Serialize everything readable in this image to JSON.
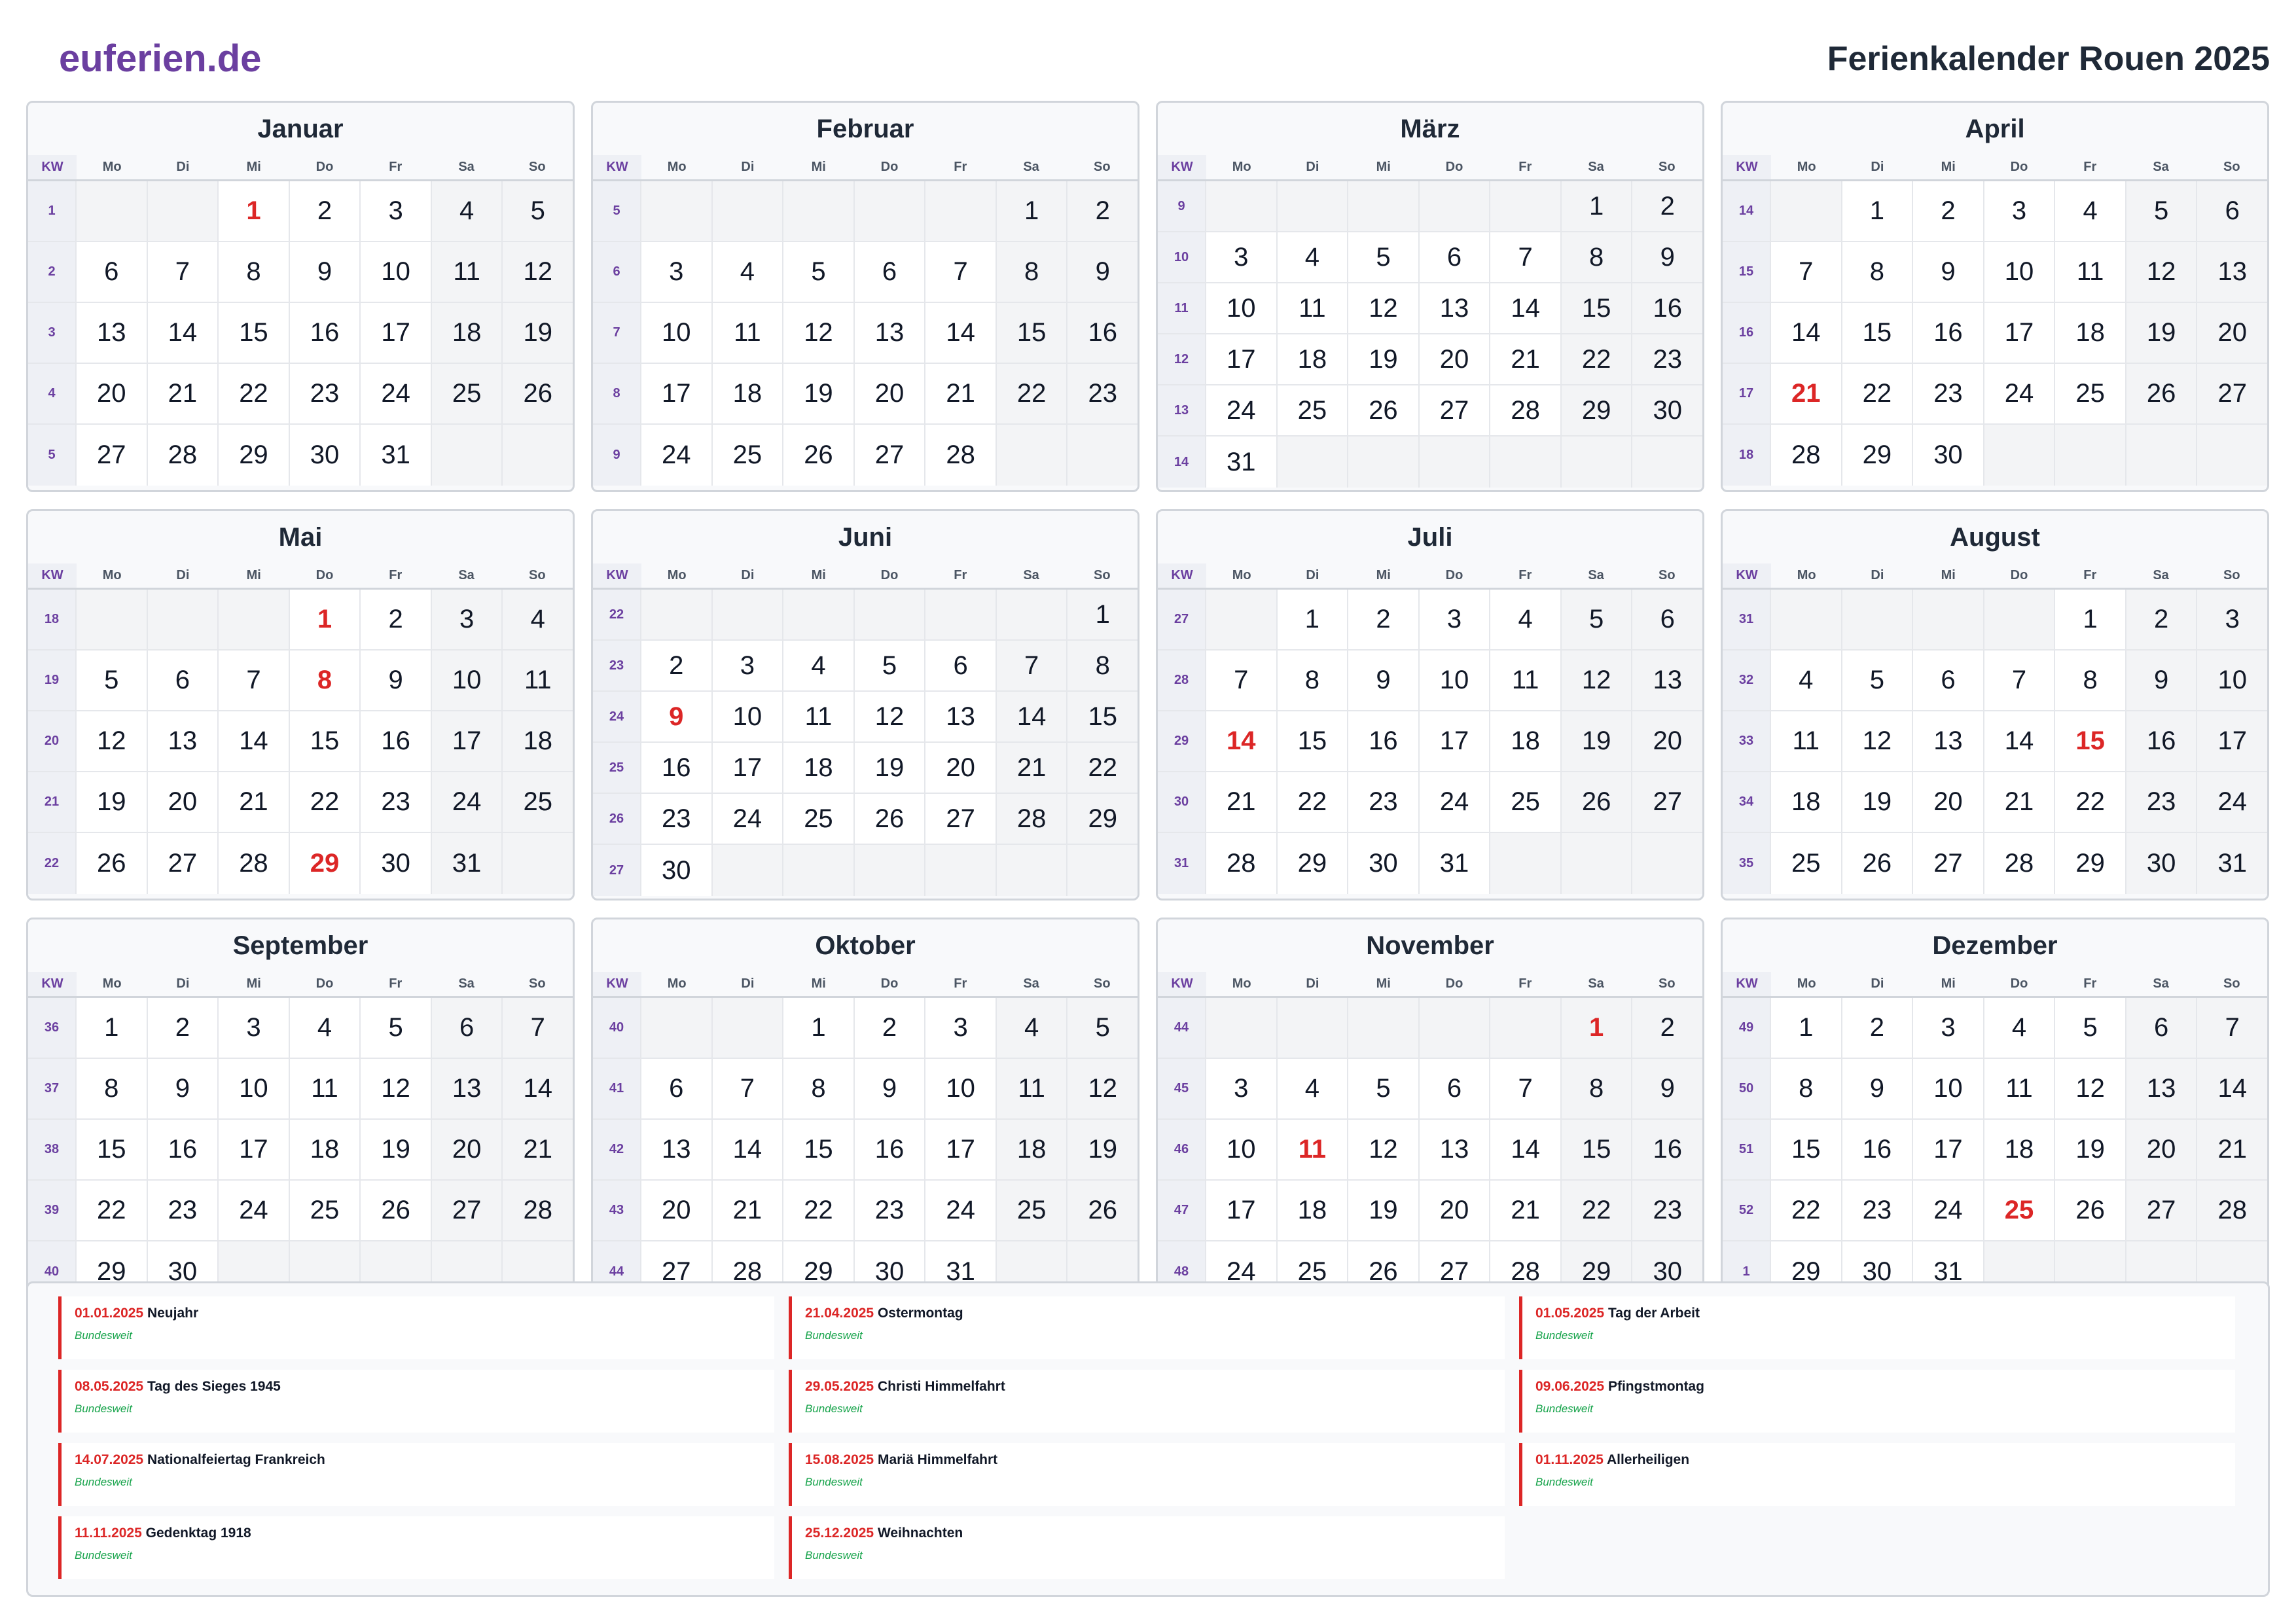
{
  "header": {
    "brand": "euferien.de",
    "title": "Ferienkalender Rouen 2025"
  },
  "calendar": {
    "kw_label": "KW",
    "weekday_labels": [
      "Mo",
      "Di",
      "Mi",
      "Do",
      "Fr",
      "Sa",
      "So"
    ],
    "months": [
      {
        "name": "Januar",
        "weeks": [
          1,
          2,
          3,
          4,
          5
        ],
        "offset": 2,
        "days": 31,
        "holidays": [
          1
        ]
      },
      {
        "name": "Februar",
        "weeks": [
          5,
          6,
          7,
          8,
          9
        ],
        "offset": 5,
        "days": 28,
        "holidays": []
      },
      {
        "name": "März",
        "weeks": [
          9,
          10,
          11,
          12,
          13,
          14
        ],
        "offset": 5,
        "days": 31,
        "holidays": []
      },
      {
        "name": "April",
        "weeks": [
          14,
          15,
          16,
          17,
          18
        ],
        "offset": 1,
        "days": 30,
        "holidays": [
          21
        ]
      },
      {
        "name": "Mai",
        "weeks": [
          18,
          19,
          20,
          21,
          22
        ],
        "offset": 3,
        "days": 31,
        "holidays": [
          1,
          8,
          29
        ]
      },
      {
        "name": "Juni",
        "weeks": [
          22,
          23,
          24,
          25,
          26,
          27
        ],
        "offset": 6,
        "days": 30,
        "holidays": [
          9
        ]
      },
      {
        "name": "Juli",
        "weeks": [
          27,
          28,
          29,
          30,
          31
        ],
        "offset": 1,
        "days": 31,
        "holidays": [
          14
        ]
      },
      {
        "name": "August",
        "weeks": [
          31,
          32,
          33,
          34,
          35
        ],
        "offset": 4,
        "days": 31,
        "holidays": [
          15
        ]
      },
      {
        "name": "September",
        "weeks": [
          36,
          37,
          38,
          39,
          40
        ],
        "offset": 0,
        "days": 30,
        "holidays": []
      },
      {
        "name": "Oktober",
        "weeks": [
          40,
          41,
          42,
          43,
          44
        ],
        "offset": 2,
        "days": 31,
        "holidays": []
      },
      {
        "name": "November",
        "weeks": [
          44,
          45,
          46,
          47,
          48
        ],
        "offset": 5,
        "days": 30,
        "holidays": [
          1,
          11
        ]
      },
      {
        "name": "Dezember",
        "weeks": [
          49,
          50,
          51,
          52,
          1
        ],
        "offset": 0,
        "days": 31,
        "holidays": [
          25
        ]
      }
    ]
  },
  "holidays": [
    {
      "date": "01.01.2025",
      "name": "Neujahr",
      "region": "Bundesweit"
    },
    {
      "date": "21.04.2025",
      "name": "Ostermontag",
      "region": "Bundesweit"
    },
    {
      "date": "01.05.2025",
      "name": "Tag der Arbeit",
      "region": "Bundesweit"
    },
    {
      "date": "08.05.2025",
      "name": "Tag des Sieges 1945",
      "region": "Bundesweit"
    },
    {
      "date": "29.05.2025",
      "name": "Christi Himmelfahrt",
      "region": "Bundesweit"
    },
    {
      "date": "09.06.2025",
      "name": "Pfingstmontag",
      "region": "Bundesweit"
    },
    {
      "date": "14.07.2025",
      "name": "Nationalfeiertag Frankreich",
      "region": "Bundesweit"
    },
    {
      "date": "15.08.2025",
      "name": "Mariä Himmelfahrt",
      "region": "Bundesweit"
    },
    {
      "date": "01.11.2025",
      "name": "Allerheiligen",
      "region": "Bundesweit"
    },
    {
      "date": "11.11.2025",
      "name": "Gedenktag 1918",
      "region": "Bundesweit"
    },
    {
      "date": "25.12.2025",
      "name": "Weihnachten",
      "region": "Bundesweit"
    }
  ]
}
